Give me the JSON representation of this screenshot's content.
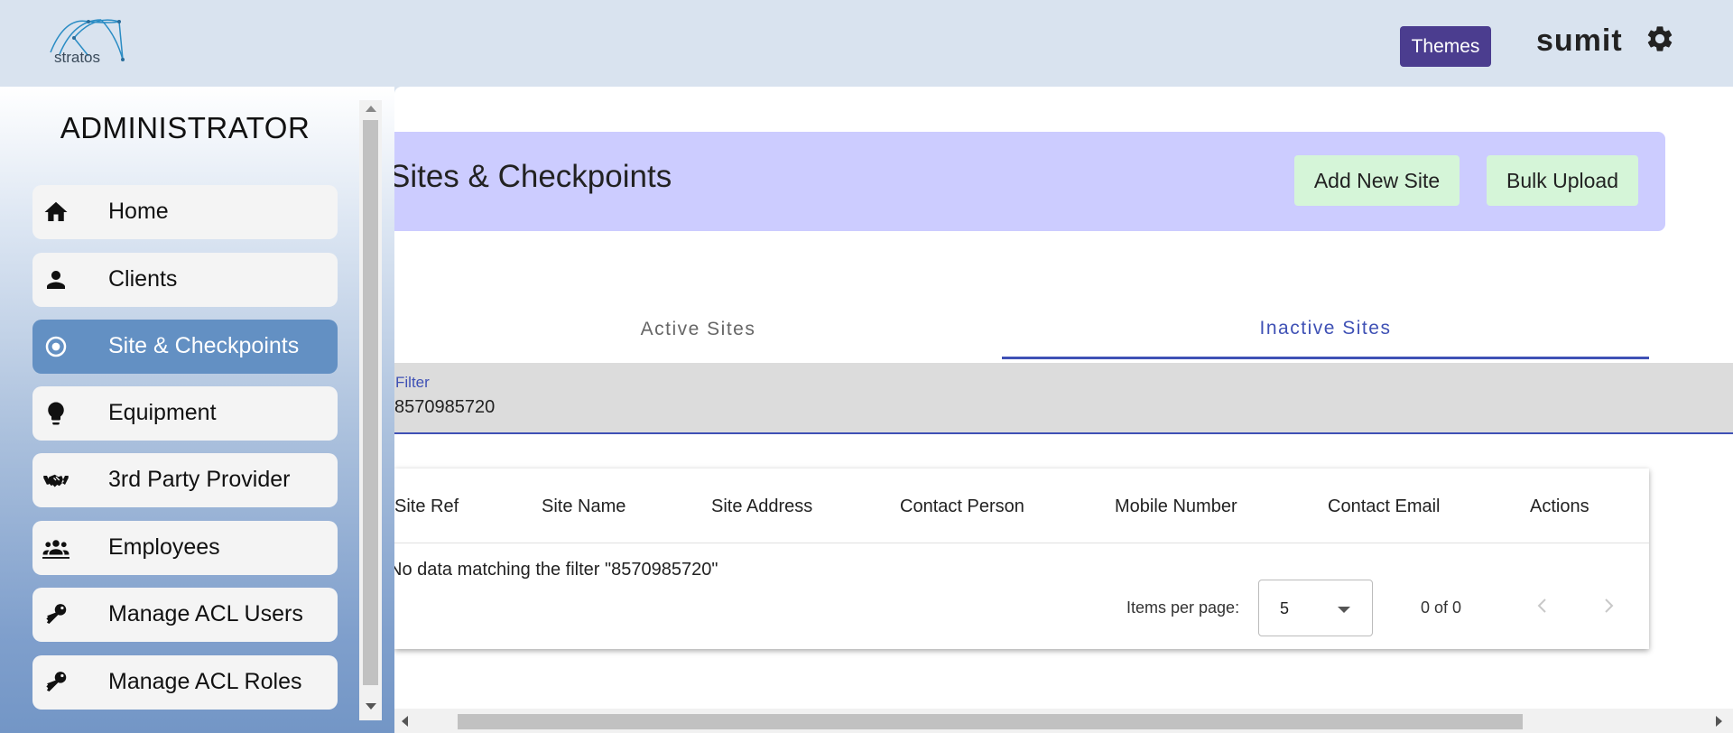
{
  "header": {
    "logo_text": "stratos",
    "themes_label": "Themes",
    "username": "sumit",
    "settings_icon": "gear-icon"
  },
  "sidebar": {
    "title": "ADMINISTRATOR",
    "items": [
      {
        "label": "Home",
        "icon": "home-icon",
        "active": false
      },
      {
        "label": "Clients",
        "icon": "person-icon",
        "active": false
      },
      {
        "label": "Site & Checkpoints",
        "icon": "target-icon",
        "active": true
      },
      {
        "label": "Equipment",
        "icon": "lightbulb-icon",
        "active": false
      },
      {
        "label": "3rd Party Provider",
        "icon": "handshake-icon",
        "active": false
      },
      {
        "label": "Employees",
        "icon": "group-icon",
        "active": false
      },
      {
        "label": "Manage ACL Users",
        "icon": "key-icon",
        "active": false
      },
      {
        "label": "Manage ACL Roles",
        "icon": "key-icon",
        "active": false
      }
    ]
  },
  "main": {
    "title": "Sites & Checkpoints",
    "add_new_site_label": "Add New Site",
    "bulk_upload_label": "Bulk Upload",
    "tabs": [
      {
        "label": "Active Sites",
        "active": false
      },
      {
        "label": "Inactive Sites",
        "active": true
      }
    ],
    "filter": {
      "label": "Filter",
      "value": "8570985720"
    },
    "table": {
      "columns": [
        "Site Ref",
        "Site Name",
        "Site Address",
        "Contact Person",
        "Mobile Number",
        "Contact Email",
        "Actions"
      ],
      "no_data_message": "No data matching the filter \"8570985720\""
    },
    "paginator": {
      "items_per_page_label": "Items per page:",
      "items_per_page_value": "5",
      "range_label": "0 of 0"
    }
  },
  "colors": {
    "accent": "#3f51b5",
    "themes_button": "#4b3d8f",
    "banner": "#ccccff",
    "action_button": "#d5f5d8",
    "sidebar_active": "#6390c3"
  }
}
